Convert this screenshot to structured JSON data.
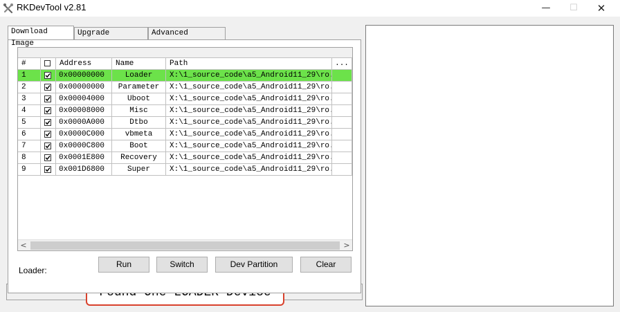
{
  "window": {
    "title": "RKDevTool v2.81",
    "controls": {
      "minimize": "—",
      "maximize": "☐",
      "close": "✕"
    }
  },
  "tabs": [
    {
      "label": "Download Image",
      "active": true
    },
    {
      "label": "Upgrade Firmware",
      "active": false
    },
    {
      "label": "Advanced Function",
      "active": false
    }
  ],
  "table": {
    "columns": [
      "#",
      "",
      "Address",
      "Name",
      "Path",
      "..."
    ],
    "rows": [
      {
        "num": "1",
        "checked": true,
        "address": "0x00000000",
        "name": "Loader",
        "path": "X:\\1_source_code\\a5_Android11_29\\ro...",
        "selected": true
      },
      {
        "num": "2",
        "checked": true,
        "address": "0x00000000",
        "name": "Parameter",
        "path": "X:\\1_source_code\\a5_Android11_29\\ro..."
      },
      {
        "num": "3",
        "checked": true,
        "address": "0x00004000",
        "name": "Uboot",
        "path": "X:\\1_source_code\\a5_Android11_29\\ro..."
      },
      {
        "num": "4",
        "checked": true,
        "address": "0x00008000",
        "name": "Misc",
        "path": "X:\\1_source_code\\a5_Android11_29\\ro..."
      },
      {
        "num": "5",
        "checked": true,
        "address": "0x0000A000",
        "name": "Dtbo",
        "path": "X:\\1_source_code\\a5_Android11_29\\ro..."
      },
      {
        "num": "6",
        "checked": true,
        "address": "0x0000C000",
        "name": "vbmeta",
        "path": "X:\\1_source_code\\a5_Android11_29\\ro..."
      },
      {
        "num": "7",
        "checked": true,
        "address": "0x0000C800",
        "name": "Boot",
        "path": "X:\\1_source_code\\a5_Android11_29\\ro..."
      },
      {
        "num": "8",
        "checked": true,
        "address": "0x0001E800",
        "name": "Recovery",
        "path": "X:\\1_source_code\\a5_Android11_29\\ro..."
      },
      {
        "num": "9",
        "checked": true,
        "address": "0x001D6800",
        "name": "Super",
        "path": "X:\\1_source_code\\a5_Android11_29\\ro..."
      }
    ],
    "scroll": {
      "left_arrow": "<",
      "right_arrow": ">"
    }
  },
  "controls": {
    "loader_label": "Loader:",
    "buttons": {
      "run": "Run",
      "switch": "Switch",
      "dev_partition": "Dev Partition",
      "clear": "Clear"
    }
  },
  "status": {
    "text": "Found One LOADER Device"
  },
  "colors": {
    "selected_row": "#6ce24a",
    "status_highlight": "#d9412c",
    "window_bg": "#f0f0f0"
  }
}
